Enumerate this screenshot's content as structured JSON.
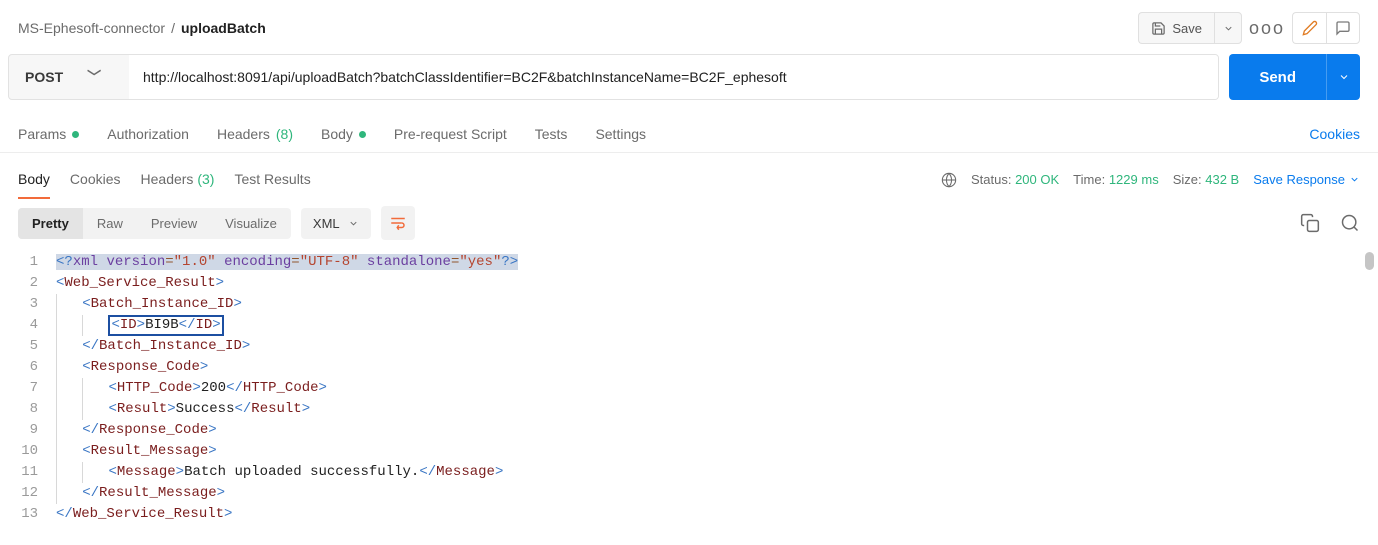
{
  "breadcrumb": {
    "parent": "MS-Ephesoft-connector",
    "sep": "/",
    "current": "uploadBatch"
  },
  "topbar": {
    "save_label": "Save",
    "more_label": "ooo"
  },
  "request": {
    "method": "POST",
    "url": "http://localhost:8091/api/uploadBatch?batchClassIdentifier=BC2F&batchInstanceName=BC2F_ephesoft",
    "send_label": "Send"
  },
  "req_tabs": {
    "params": "Params",
    "auth": "Authorization",
    "headers_label": "Headers",
    "headers_count": "(8)",
    "body": "Body",
    "prereq": "Pre-request Script",
    "tests": "Tests",
    "settings": "Settings",
    "cookies": "Cookies"
  },
  "resp_tabs": {
    "body": "Body",
    "cookies": "Cookies",
    "headers_label": "Headers",
    "headers_count": "(3)",
    "tests": "Test Results"
  },
  "resp_meta": {
    "status_label": "Status:",
    "status_value": "200 OK",
    "time_label": "Time:",
    "time_value": "1229 ms",
    "size_label": "Size:",
    "size_value": "432 B",
    "save_response": "Save Response"
  },
  "viewer": {
    "pretty": "Pretty",
    "raw": "Raw",
    "preview": "Preview",
    "visualize": "Visualize",
    "format": "XML"
  },
  "xml": {
    "decl": {
      "lt": "<?",
      "xml": "xml",
      "version_k": "version",
      "version_v": "\"1.0\"",
      "encoding_k": "encoding",
      "encoding_v": "\"UTF-8\"",
      "standalone_k": "standalone",
      "standalone_v": "\"yes\"",
      "gt": "?>"
    },
    "root": "Web_Service_Result",
    "bid": "Batch_Instance_ID",
    "id_tag": "ID",
    "id_val": "BI9B",
    "rcode": "Response_Code",
    "http": "HTTP_Code",
    "http_val": "200",
    "result": "Result",
    "result_val": "Success",
    "rmsg": "Result_Message",
    "msg": "Message",
    "msg_val": "Batch uploaded successfully."
  },
  "ln": {
    "1": "1",
    "2": "2",
    "3": "3",
    "4": "4",
    "5": "5",
    "6": "6",
    "7": "7",
    "8": "8",
    "9": "9",
    "10": "10",
    "11": "11",
    "12": "12",
    "13": "13"
  },
  "chart_data": {
    "type": "table",
    "title": "uploadBatch XML response",
    "series": [
      {
        "name": "Batch_Instance_ID.ID",
        "values": [
          "BI9B"
        ]
      },
      {
        "name": "Response_Code.HTTP_Code",
        "values": [
          200
        ]
      },
      {
        "name": "Response_Code.Result",
        "values": [
          "Success"
        ]
      },
      {
        "name": "Result_Message.Message",
        "values": [
          "Batch uploaded successfully."
        ]
      }
    ]
  }
}
